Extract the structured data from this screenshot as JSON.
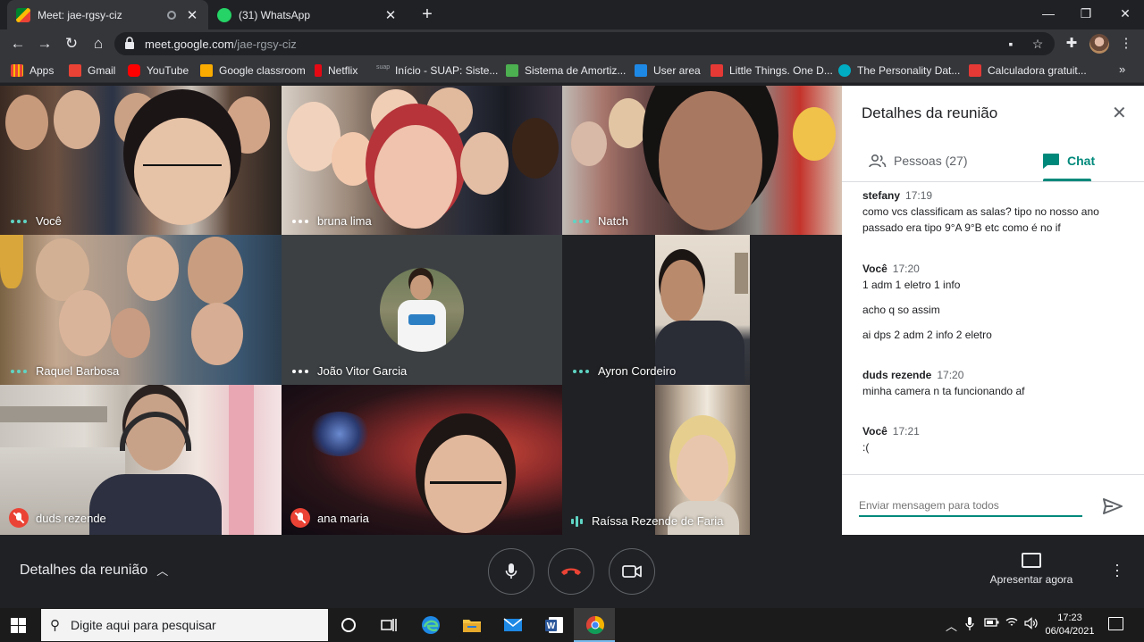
{
  "browser": {
    "tabs": [
      {
        "title": "Meet: jae-rgsy-ciz",
        "active": true
      },
      {
        "title": "(31) WhatsApp",
        "active": false
      }
    ],
    "url_host": "meet.google.com",
    "url_path": "/jae-rgsy-ciz",
    "bookmarks": [
      {
        "label": "Apps",
        "icon": "apps-grid-icon",
        "color": "#ea4335"
      },
      {
        "label": "Gmail",
        "icon": "gmail-icon",
        "color": "#ea4335"
      },
      {
        "label": "YouTube",
        "icon": "youtube-icon",
        "color": "#ff0000"
      },
      {
        "label": "Google classroom",
        "icon": "classroom-icon",
        "color": "#f9ab00"
      },
      {
        "label": "Netflix",
        "icon": "netflix-icon",
        "color": "#e50914"
      },
      {
        "label": "Início - SUAP: Siste...",
        "icon": "suap-icon",
        "color": "#5f6368"
      },
      {
        "label": "Sistema de Amortiz...",
        "icon": "dollar-icon",
        "color": "#4caf50"
      },
      {
        "label": "User area",
        "icon": "tl-icon",
        "color": "#1e88e5"
      },
      {
        "label": "Little Things. One D...",
        "icon": "guitar-icon",
        "color": "#e53935"
      },
      {
        "label": "The Personality Dat...",
        "icon": "personality-db-icon",
        "color": "#00acc1"
      },
      {
        "label": "Calculadora gratuit...",
        "icon": "calculator-icon",
        "color": "#e53935"
      }
    ]
  },
  "meet": {
    "participants": [
      {
        "name": "Você",
        "status": "dots"
      },
      {
        "name": "bruna lima",
        "status": "dots"
      },
      {
        "name": "Natch",
        "status": "dots"
      },
      {
        "name": "Raquel Barbosa",
        "status": "dots"
      },
      {
        "name": "João Vitor Garcia",
        "status": "dots"
      },
      {
        "name": "Ayron Cordeiro",
        "status": "dots"
      },
      {
        "name": "duds rezende",
        "status": "muted"
      },
      {
        "name": "ana maria",
        "status": "muted"
      },
      {
        "name": "Raíssa Rezende de Faria",
        "status": "speaking"
      }
    ],
    "panel": {
      "title": "Detalhes da reunião",
      "people_tab": "Pessoas (27)",
      "chat_tab": "Chat",
      "messages": [
        {
          "sender": "stefany",
          "time": "17:19",
          "lines": [
            "como vcs classificam as salas? tipo no nosso ano passado era tipo 9°A  9°B etc como é no if"
          ]
        },
        {
          "sender": "Você",
          "time": "17:20",
          "lines": [
            "1 adm 1 eletro 1 info",
            "acho q so assim",
            "ai dps 2 adm 2 info 2 eletro"
          ]
        },
        {
          "sender": "duds rezende",
          "time": "17:20",
          "lines": [
            "minha camera n ta funcionando af"
          ]
        },
        {
          "sender": "Você",
          "time": "17:21",
          "lines": [
            ":("
          ]
        }
      ],
      "input_placeholder": "Enviar mensagem para todos"
    },
    "bottom": {
      "details_label": "Detalhes da reunião",
      "present_label": "Apresentar agora",
      "end_call_color": "#ea4335",
      "accent_color": "#00897b"
    }
  },
  "taskbar": {
    "search_placeholder": "Digite aqui para pesquisar",
    "time": "17:23",
    "date": "06/04/2021"
  }
}
